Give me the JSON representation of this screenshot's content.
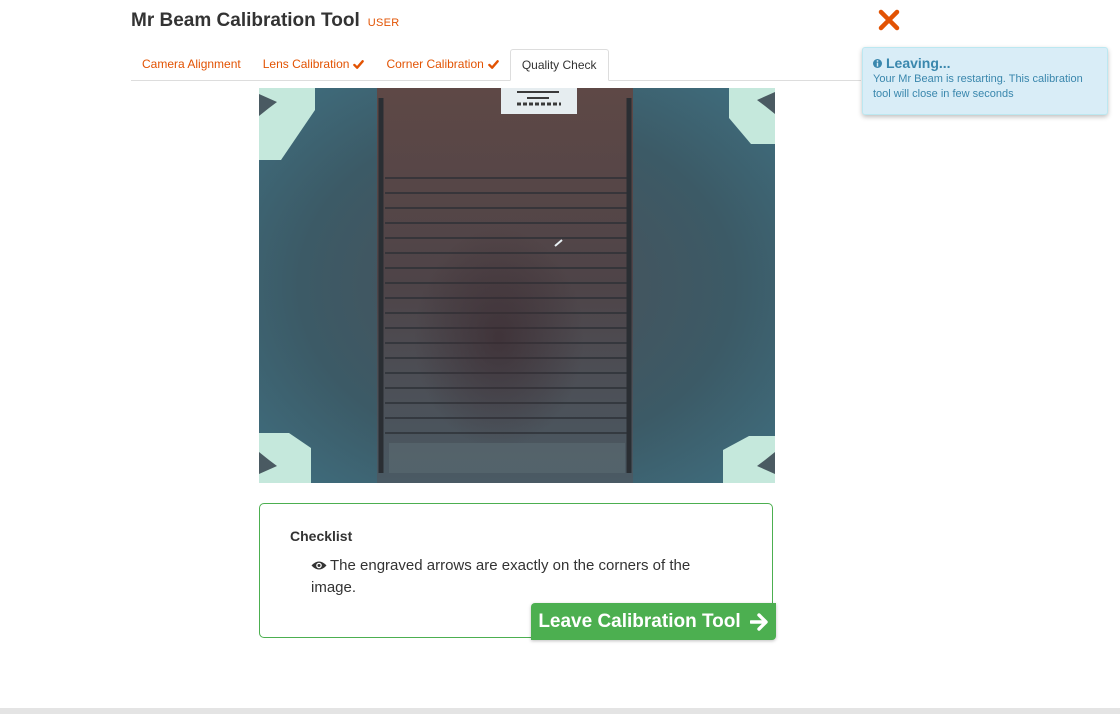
{
  "header": {
    "title": "Mr Beam Calibration Tool",
    "role_badge": "USER"
  },
  "tabs": [
    {
      "label": "Camera Alignment",
      "completed": false,
      "active": false
    },
    {
      "label": "Lens Calibration",
      "completed": true,
      "active": false
    },
    {
      "label": "Corner Calibration",
      "completed": true,
      "active": false
    },
    {
      "label": "Quality Check",
      "completed": false,
      "active": true
    }
  ],
  "checklist": {
    "title": "Checklist",
    "item": "The engraved arrows are exactly on the corners of the image."
  },
  "leave_button": {
    "label": "Leave Calibration Tool"
  },
  "notification": {
    "title": "Leaving...",
    "message": "Your Mr Beam is restarting. This calibration tool will close in few seconds"
  },
  "colors": {
    "accent": "#e25303",
    "success": "#4caf50",
    "info_bg": "#d9edf7",
    "info_text": "#3a87ad"
  },
  "icons": {
    "close": "close-icon",
    "check": "check-icon",
    "eye": "eye-icon",
    "arrow": "arrow-right-icon",
    "info": "info-icon"
  }
}
